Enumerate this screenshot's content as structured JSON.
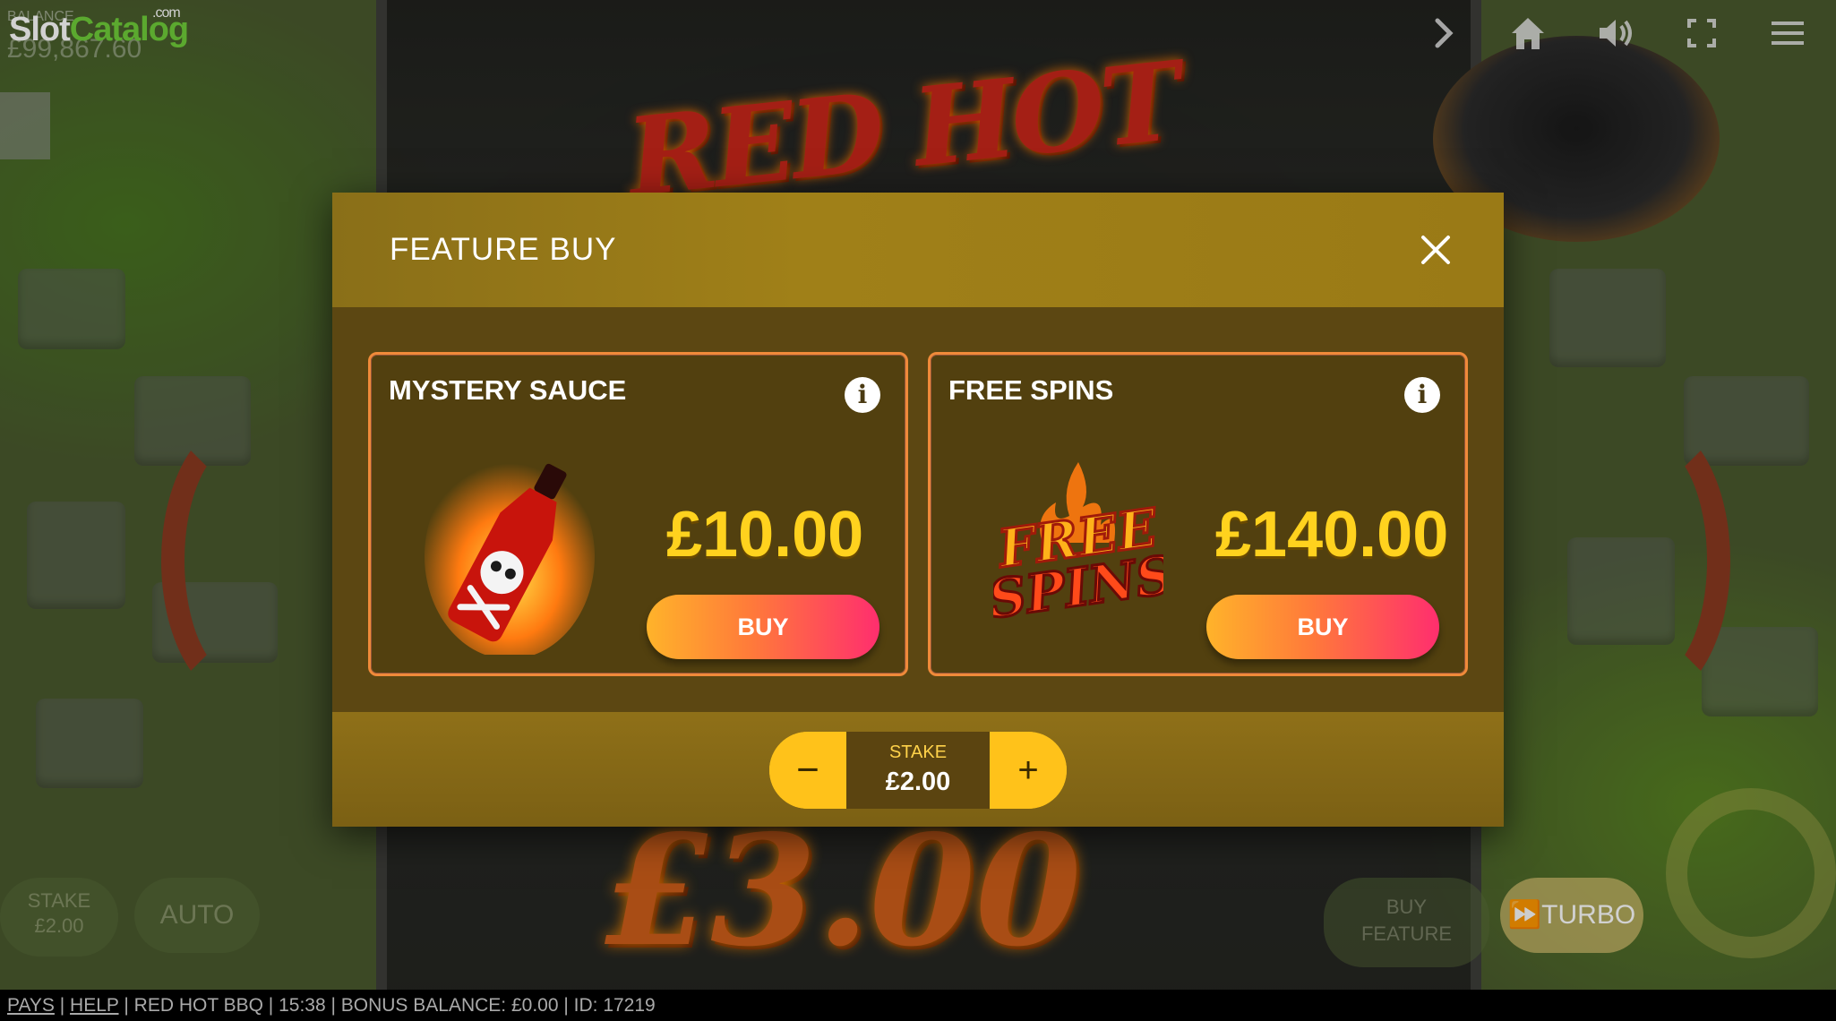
{
  "branding": {
    "site_logo_part1": "Slot",
    "site_logo_part2": "Catalog",
    "site_logo_suffix": ".com",
    "game_logo": "RED HOT BBQ"
  },
  "hud": {
    "balance_label": "BALANCE",
    "balance_value": "£99,867.60",
    "stake_label": "STAKE",
    "stake_value": "£2.00",
    "auto_label": "AUTO",
    "buy_feature_label": "BUY FEATURE",
    "turbo_label": "TURBO",
    "big_win_value": "£3.00",
    "icons": [
      "chevron-right-icon",
      "home-icon",
      "speaker-icon",
      "fullscreen-icon",
      "menu-icon"
    ]
  },
  "bottom_bar": {
    "pays": "PAYS",
    "help": "HELP",
    "info": "RED HOT BBQ | 15:38 | BONUS BALANCE: £0.00 | ID: 17219"
  },
  "modal": {
    "title": "FEATURE BUY",
    "close_symbol": "✕",
    "cards": [
      {
        "title": "MYSTERY SAUCE",
        "price": "£10.00",
        "buy_label": "BUY",
        "info_symbol": "i",
        "image": "hot-sauce-bottle"
      },
      {
        "title": "FREE SPINS",
        "price": "£140.00",
        "buy_label": "BUY",
        "info_symbol": "i",
        "image": "free-spins-logo"
      }
    ],
    "stake": {
      "label": "STAKE",
      "value": "£2.00",
      "minus": "−",
      "plus": "+"
    }
  },
  "colors": {
    "modal_header": "#9a7a16",
    "price": "#ffd21e",
    "card_border": "#f08a3a",
    "stake_button": "#ffc21a"
  }
}
